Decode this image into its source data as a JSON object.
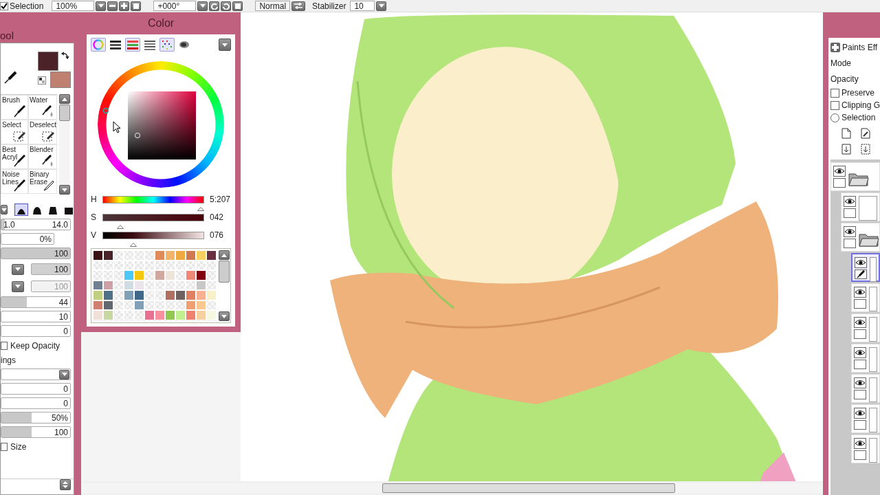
{
  "toolbar": {
    "selection": {
      "label": "Selection",
      "checked": true
    },
    "zoom": "100%",
    "angle": "+000°",
    "blend_mode": "Normal",
    "stabilizer_label": "Stabilizer",
    "stabilizer": "10"
  },
  "tool_panel": {
    "title": "ool",
    "current_colors": [
      {
        "kind": "main",
        "color": "#4a2228"
      },
      {
        "kind": "sub",
        "color": "#c08070"
      }
    ],
    "tools": [
      {
        "label": "Brush",
        "kind": "pen"
      },
      {
        "label": "Water",
        "kind": "water"
      },
      {
        "label": "Select",
        "kind": "select"
      },
      {
        "label": "Deselect",
        "kind": "select"
      },
      {
        "label": "Best Acryl",
        "kind": "pen"
      },
      {
        "label": "Blender",
        "kind": "water"
      },
      {
        "label": "Noise Lines",
        "kind": "pen"
      },
      {
        "label": "Binary Erase",
        "kind": "eraser"
      }
    ],
    "brush_shapes": [
      {
        "selected": true
      },
      {
        "selected": false
      },
      {
        "selected": false
      },
      {
        "selected": false
      }
    ],
    "settings": [
      {
        "kind": "range",
        "min": "1.0",
        "value": "14.0",
        "level": 0.05
      },
      {
        "kind": "short",
        "value": "0%"
      },
      {
        "kind": "slider",
        "value": "100",
        "level": 1
      },
      {
        "kind": "combo",
        "value": "100",
        "disabled": false
      },
      {
        "kind": "combo",
        "value": "100",
        "disabled": true
      },
      {
        "kind": "slider",
        "value": "44",
        "level": 0.37
      },
      {
        "kind": "slider",
        "value": "10"
      },
      {
        "kind": "slider",
        "value": "0"
      },
      {
        "kind": "checkbox",
        "label": "Keep Opacity",
        "checked": false
      },
      {
        "kind": "label",
        "label": "ings"
      },
      {
        "kind": "dropdown"
      },
      {
        "kind": "slider",
        "value": "0"
      },
      {
        "kind": "slider",
        "value": "0"
      },
      {
        "kind": "slider",
        "value": "50%",
        "level": 0.44
      },
      {
        "kind": "slider",
        "value": "100",
        "level": 0.44
      },
      {
        "kind": "checkbox",
        "label": "Size",
        "checked": false
      }
    ]
  },
  "color_panel": {
    "title": "Color",
    "modes": [
      {
        "kind": "wheel",
        "selected": true
      },
      {
        "kind": "gray",
        "selected": false
      },
      {
        "kind": "rgb",
        "selected": true
      },
      {
        "kind": "hsv",
        "selected": false
      },
      {
        "kind": "swatches",
        "selected": true
      },
      {
        "kind": "scratch",
        "selected": false
      }
    ],
    "sliders": [
      {
        "label": "H",
        "value": "5:207",
        "level": 0.97,
        "kind": "hue"
      },
      {
        "label": "S",
        "value": "042",
        "level": 0.17,
        "kind": "sat"
      },
      {
        "label": "V",
        "value": "076",
        "level": 0.3,
        "kind": "val"
      }
    ],
    "swatches": [
      {
        "kind": "color",
        "color": "#3a1015"
      },
      {
        "kind": "color",
        "color": "#4a2228"
      },
      {
        "kind": "empty"
      },
      {
        "kind": "empty"
      },
      {
        "kind": "empty"
      },
      {
        "kind": "empty"
      },
      {
        "kind": "color",
        "color": "#e08a5a"
      },
      {
        "kind": "color",
        "color": "#f2b46a"
      },
      {
        "kind": "color",
        "color": "#f0a840"
      },
      {
        "kind": "color",
        "color": "#d07850"
      },
      {
        "kind": "color",
        "color": "#f8d060"
      },
      {
        "kind": "color",
        "color": "#6a3040"
      },
      {
        "kind": "empty"
      },
      {
        "kind": "empty"
      },
      {
        "kind": "empty"
      },
      {
        "kind": "empty"
      },
      {
        "kind": "empty"
      },
      {
        "kind": "empty"
      },
      {
        "kind": "empty"
      },
      {
        "kind": "empty"
      },
      {
        "kind": "empty"
      },
      {
        "kind": "empty"
      },
      {
        "kind": "empty"
      },
      {
        "kind": "empty"
      },
      {
        "kind": "empty"
      },
      {
        "kind": "empty"
      },
      {
        "kind": "empty"
      },
      {
        "kind": "color",
        "color": "#4cc8f8"
      },
      {
        "kind": "color",
        "color": "#f8c810"
      },
      {
        "kind": "empty"
      },
      {
        "kind": "color",
        "color": "#d0a8a0"
      },
      {
        "kind": "color",
        "color": "#eee4d8"
      },
      {
        "kind": "empty"
      },
      {
        "kind": "color",
        "color": "#f08878"
      },
      {
        "kind": "color",
        "color": "#800010"
      },
      {
        "kind": "empty"
      },
      {
        "kind": "color",
        "color": "#708090"
      },
      {
        "kind": "color",
        "color": "#d0a0a8"
      },
      {
        "kind": "empty"
      },
      {
        "kind": "color",
        "color": "#d0dce4"
      },
      {
        "kind": "color",
        "color": "#ece4ec"
      },
      {
        "kind": "empty"
      },
      {
        "kind": "empty"
      },
      {
        "kind": "empty"
      },
      {
        "kind": "empty"
      },
      {
        "kind": "empty"
      },
      {
        "kind": "color",
        "color": "#c8c8c8"
      },
      {
        "kind": "empty"
      },
      {
        "kind": "color",
        "color": "#c0d080"
      },
      {
        "kind": "color",
        "color": "#507088"
      },
      {
        "kind": "empty"
      },
      {
        "kind": "color",
        "color": "#80a0b8"
      },
      {
        "kind": "color",
        "color": "#406888"
      },
      {
        "kind": "empty"
      },
      {
        "kind": "empty"
      },
      {
        "kind": "color",
        "color": "#b07060"
      },
      {
        "kind": "color",
        "color": "#706060"
      },
      {
        "kind": "color",
        "color": "#e08060"
      },
      {
        "kind": "color",
        "color": "#f8b090"
      },
      {
        "kind": "color",
        "color": "#f8f0c8"
      },
      {
        "kind": "color",
        "color": "#d08070"
      },
      {
        "kind": "color",
        "color": "#606870"
      },
      {
        "kind": "empty"
      },
      {
        "kind": "empty"
      },
      {
        "kind": "color",
        "color": "#80a0b8"
      },
      {
        "kind": "empty"
      },
      {
        "kind": "empty"
      },
      {
        "kind": "empty"
      },
      {
        "kind": "empty"
      },
      {
        "kind": "color",
        "color": "#f0a070"
      },
      {
        "kind": "color",
        "color": "#f8c890"
      },
      {
        "kind": "empty"
      },
      {
        "kind": "color",
        "color": "#f0e0d8"
      },
      {
        "kind": "color",
        "color": "#c8d8a0"
      },
      {
        "kind": "empty"
      },
      {
        "kind": "empty"
      },
      {
        "kind": "empty"
      },
      {
        "kind": "color",
        "color": "#e87090"
      },
      {
        "kind": "color",
        "color": "#f890a0"
      },
      {
        "kind": "color",
        "color": "#90c850"
      },
      {
        "kind": "color",
        "color": "#c0f090"
      },
      {
        "kind": "color",
        "color": "#f08070"
      },
      {
        "kind": "color",
        "color": "#f8d0a0"
      },
      {
        "kind": "color",
        "color": "#f8f8e0"
      }
    ]
  },
  "layer_panel": {
    "title": "Paints Eff",
    "mode_label": "Mode",
    "opacity_label": "Opacity",
    "options": [
      {
        "kind": "checkbox",
        "label": "Preserve",
        "checked": false
      },
      {
        "kind": "checkbox",
        "label": "Clipping G",
        "checked": false
      },
      {
        "kind": "radio",
        "label": "Selection",
        "checked": false
      }
    ],
    "layers": [
      {
        "kind": "folder",
        "selected": false,
        "children": [
          {
            "kind": "layer",
            "selected": false
          },
          {
            "kind": "folder",
            "selected": false,
            "children": [
              {
                "kind": "layer",
                "selected": true
              },
              {
                "kind": "layer",
                "selected": false
              },
              {
                "kind": "layer",
                "selected": false
              },
              {
                "kind": "layer",
                "selected": false
              },
              {
                "kind": "layer",
                "selected": false
              },
              {
                "kind": "layer",
                "selected": false
              },
              {
                "kind": "layer",
                "selected": false
              }
            ]
          }
        ]
      }
    ]
  }
}
